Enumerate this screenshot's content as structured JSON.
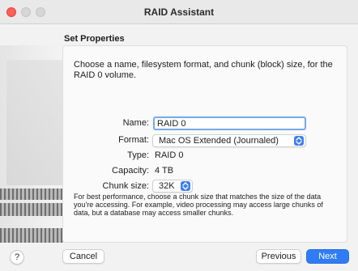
{
  "window": {
    "title": "RAID Assistant"
  },
  "header": {
    "section_title": "Set Properties"
  },
  "intro": "Choose a name, filesystem format, and chunk (block) size, for the RAID 0 volume.",
  "form": {
    "name_label": "Name:",
    "name_value": "RAID 0",
    "format_label": "Format:",
    "format_value": "Mac OS Extended (Journaled)",
    "type_label": "Type:",
    "type_value": "RAID 0",
    "capacity_label": "Capacity:",
    "capacity_value": "4 TB",
    "chunk_label": "Chunk size:",
    "chunk_value": "32K"
  },
  "footnote": "For best performance, choose a chunk size that matches the size of the data you're accessing. For example, video processing may access large chunks of data, but a database may access smaller chunks.",
  "buttons": {
    "help": "?",
    "cancel": "Cancel",
    "previous": "Previous",
    "next": "Next"
  },
  "colors": {
    "accent": "#2f7cf6",
    "close": "#ff5f57",
    "focus_ring": "#78a8e8"
  },
  "icons": {
    "close": "close-window-icon",
    "minimize": "minimize-window-icon",
    "maximize": "zoom-window-icon",
    "popup": "chevron-updown-icon"
  }
}
